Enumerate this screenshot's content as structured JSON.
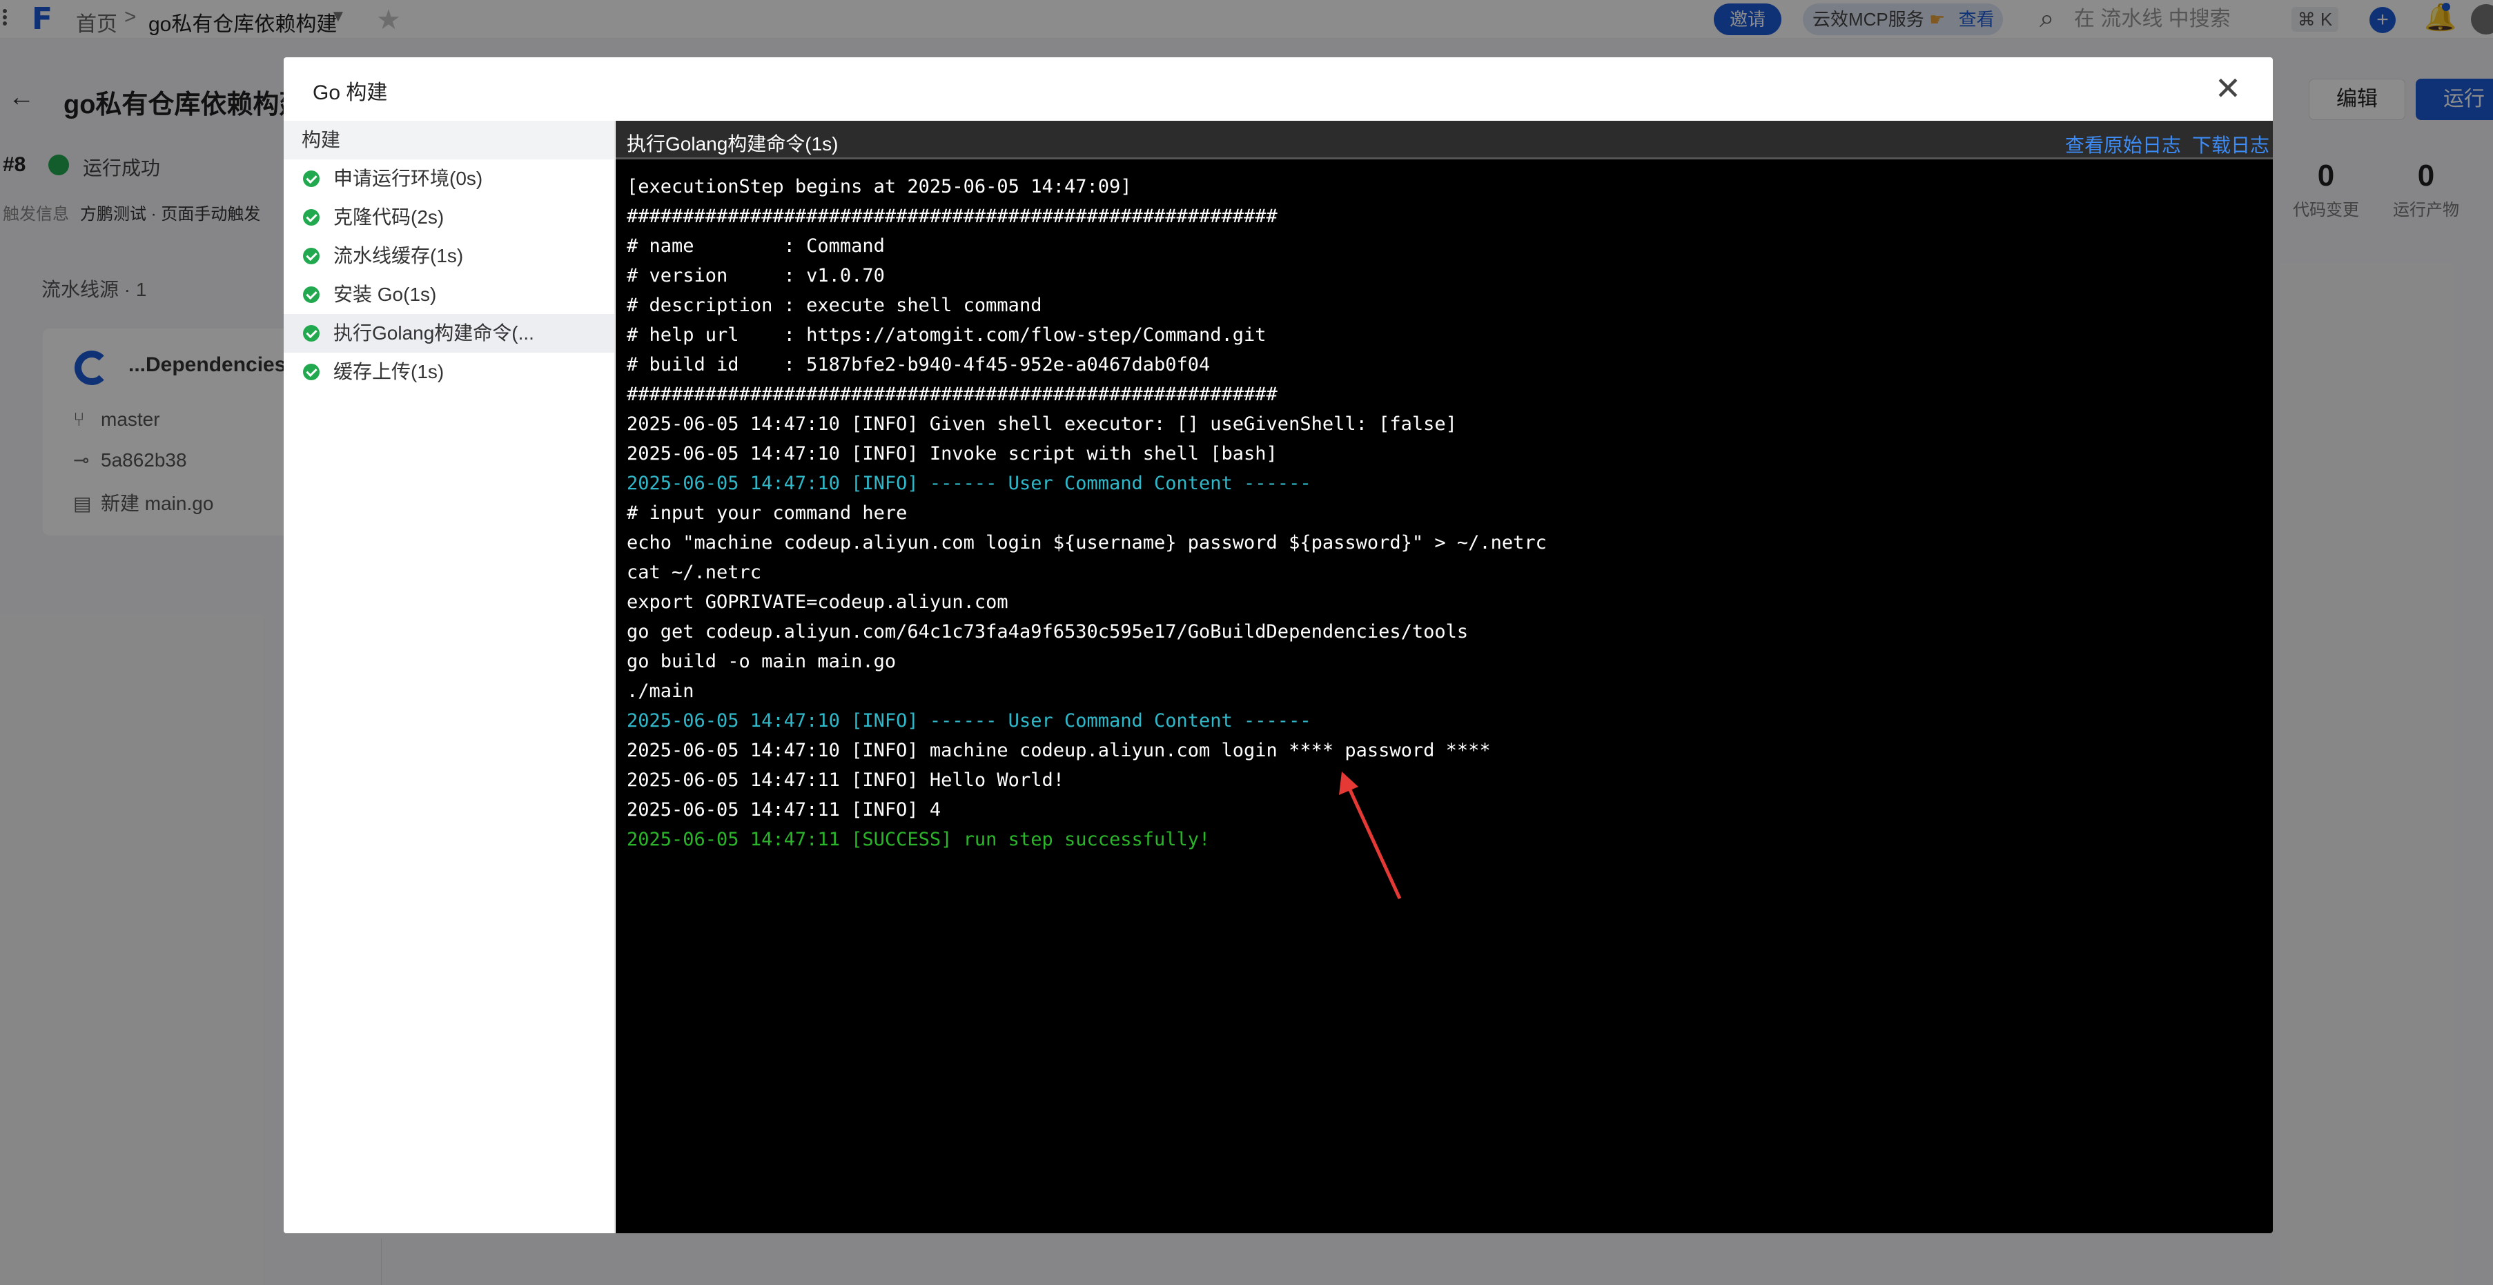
{
  "topbar": {
    "home": "首页",
    "separator": ">",
    "current": "go私有仓库依赖构建",
    "invite": "邀请",
    "mcp_text": "云效MCP服务",
    "mcp_view": "查看",
    "search_placeholder": "在 流水线 中搜索",
    "shortcut": "⌘ K"
  },
  "page": {
    "title": "go私有仓库依赖构建",
    "run_no": "#8",
    "run_status": "运行成功",
    "trigger_label": "触发信息",
    "trigger_value": "方鹏测试 · 页面手动触发",
    "edit": "编辑",
    "run": "运行",
    "stats": [
      {
        "num": "0",
        "label": "代码变更"
      },
      {
        "num": "0",
        "label": "运行产物"
      }
    ],
    "sources_label": "流水线源 · 1",
    "source": {
      "name": "...Dependencies",
      "branch": "master",
      "commit": "5a862b38",
      "message": "新建 main.go"
    }
  },
  "modal": {
    "title": "Go 构建",
    "sidebar_head": "构建",
    "steps": [
      "申请运行环境(0s)",
      "克隆代码(2s)",
      "流水线缓存(1s)",
      "安装 Go(1s)",
      "执行Golang构建命令(...",
      "缓存上传(1s)"
    ],
    "active_step": 4,
    "log_title": "执行Golang构建命令(1s)",
    "view_raw": "查看原始日志",
    "download": "下载日志",
    "log_lines": [
      {
        "text": "[executionStep begins at 2025-06-05 14:47:09]",
        "kind": "info"
      },
      {
        "text": "##########################################################",
        "kind": "info"
      },
      {
        "text": "# name        : Command",
        "kind": "info"
      },
      {
        "text": "# version     : v1.0.70",
        "kind": "info"
      },
      {
        "text": "# description : execute shell command",
        "kind": "info"
      },
      {
        "text": "# help url    : https://atomgit.com/flow-step/Command.git",
        "kind": "info"
      },
      {
        "text": "# build id    : 5187bfe2-b940-4f45-952e-a0467dab0f04",
        "kind": "info"
      },
      {
        "text": "##########################################################",
        "kind": "info"
      },
      {
        "text": "2025-06-05 14:47:10 [INFO] Given shell executor: [] useGivenShell: [false]",
        "kind": "info"
      },
      {
        "text": "2025-06-05 14:47:10 [INFO] Invoke script with shell [bash]",
        "kind": "info"
      },
      {
        "text": "2025-06-05 14:47:10 [INFO] ------ User Command Content ------",
        "kind": "cyan"
      },
      {
        "text": "# input your command here",
        "kind": "info"
      },
      {
        "text": "echo \"machine codeup.aliyun.com login ${username} password ${password}\" > ~/.netrc",
        "kind": "info"
      },
      {
        "text": "cat ~/.netrc",
        "kind": "info"
      },
      {
        "text": "export GOPRIVATE=codeup.aliyun.com",
        "kind": "info"
      },
      {
        "text": "go get codeup.aliyun.com/64c1c73fa4a9f6530c595e17/GoBuildDependencies/tools",
        "kind": "info"
      },
      {
        "text": "go build -o main main.go",
        "kind": "info"
      },
      {
        "text": "./main",
        "kind": "info"
      },
      {
        "text": "2025-06-05 14:47:10 [INFO] ------ User Command Content ------",
        "kind": "cyan"
      },
      {
        "text": "2025-06-05 14:47:10 [INFO] machine codeup.aliyun.com login **** password ****",
        "kind": "info"
      },
      {
        "text": "2025-06-05 14:47:11 [INFO] Hello World!",
        "kind": "info"
      },
      {
        "text": "2025-06-05 14:47:11 [INFO] 4",
        "kind": "info"
      },
      {
        "text": "2025-06-05 14:47:11 [SUCCESS] run step successfully!",
        "kind": "success"
      }
    ]
  },
  "colors": {
    "accent": "#1d5bd8",
    "success": "#22a94f",
    "log_cyan": "#2fb8c9",
    "log_success": "#2bb52b",
    "annotation_arrow": "#e53935"
  },
  "annotation": "red-arrow-pointing-to-masked-credentials"
}
